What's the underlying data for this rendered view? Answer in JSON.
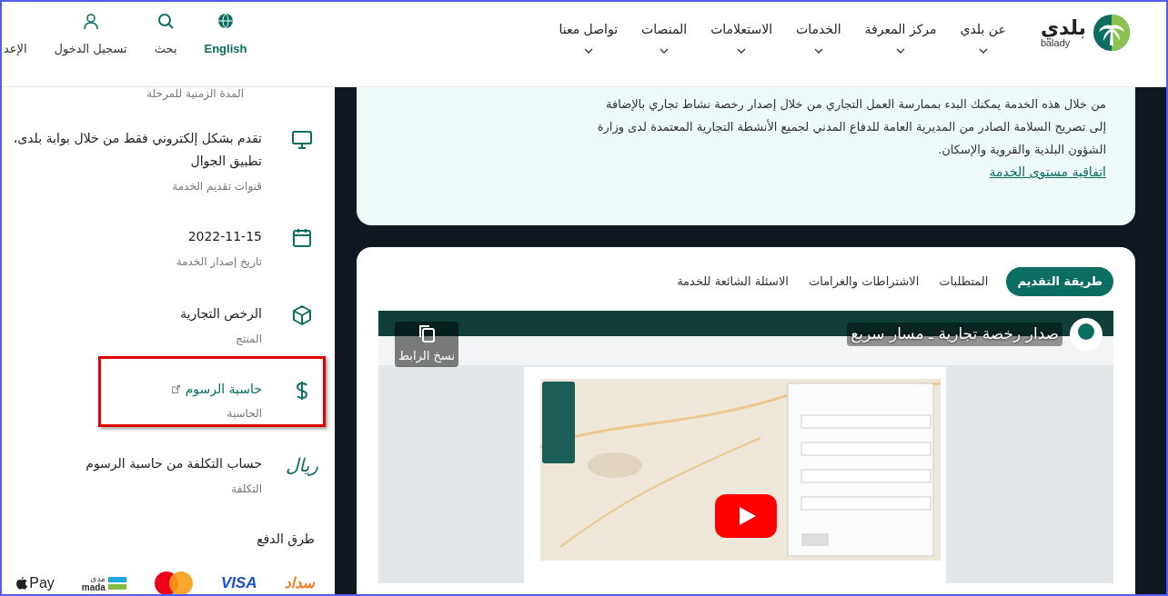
{
  "nav": {
    "logo": {
      "arabic": "بلدي",
      "latin": "balady"
    },
    "items": [
      {
        "label": "عن بلدي"
      },
      {
        "label": "مركز المعرفة"
      },
      {
        "label": "الخدمات"
      },
      {
        "label": "الاستعلامات"
      },
      {
        "label": "المنصات"
      },
      {
        "label": "تواصل معنا"
      }
    ],
    "utilities": [
      {
        "kind": "language",
        "label": "English"
      },
      {
        "kind": "search",
        "label": "بحث"
      },
      {
        "kind": "login",
        "label": "تسجيل الدخول"
      },
      {
        "kind": "settings",
        "label": "الإعد"
      }
    ]
  },
  "description": {
    "lines": [
      "من خلال هذه الخدمة يمكنك البدء بممارسة العمل التجاري من خلال إصدار رخصة نشاط تجاري بالإضافة",
      "إلى تصريح السلامة الصادر من المديرية العامة للدفاع المدني لجميع الأنشطة التجارية المعتمدة لدى وزارة",
      "الشؤون البلدية والقروية والإسكان."
    ],
    "link": "اتفاقية مستوى الخدمة"
  },
  "tabs": [
    {
      "label": "طريقة التقديم",
      "selected": true
    },
    {
      "label": "المتطلبات",
      "selected": false
    },
    {
      "label": "الاشتراطات والغرامات",
      "selected": false
    },
    {
      "label": "الاسئلة الشائعة للخدمة",
      "selected": false
    }
  ],
  "video": {
    "kind": "picture",
    "title": "صدار رخصة تجارية ـ مسار سريع",
    "copy_link": "نسخ الرابط"
  },
  "sidebar": {
    "clipped_label": "المدة الزمنية للمرحلة",
    "items": [
      {
        "kind": "monitor",
        "lines": [
          "تقدم بشكل إلكتروني فقط من خلال بوابة بلدى،",
          "تطبيق الجوال"
        ],
        "label": "قنوات تقديم الخدمة",
        "link": false,
        "highlighted": false
      },
      {
        "kind": "calendar",
        "lines": [
          "2022-11-15"
        ],
        "label": "تاريخ إصدار الخدمة",
        "link": false,
        "highlighted": false
      },
      {
        "kind": "box",
        "lines": [
          "الرخص التجارية"
        ],
        "label": "المنتج",
        "link": false,
        "highlighted": false
      },
      {
        "kind": "dollar",
        "lines": [
          "حاسبة الرسوم"
        ],
        "label": "الحاسبة",
        "link": true,
        "highlighted": true
      },
      {
        "kind": "riyal",
        "icon_text": "ريال",
        "lines": [
          "حساب التكلفة من حاسبة الرسوم"
        ],
        "label": "التكلفة",
        "link": false,
        "highlighted": false
      }
    ],
    "payment": {
      "heading": "طرق الدفع",
      "methods": [
        {
          "kind": "sadad",
          "label": "سداد"
        },
        {
          "kind": "visa",
          "label": "VISA"
        },
        {
          "kind": "mastercard"
        },
        {
          "kind": "mada",
          "label_ar": "مدى",
          "label": "mada"
        },
        {
          "kind": "applepay",
          "label": "Pay"
        }
      ]
    }
  }
}
